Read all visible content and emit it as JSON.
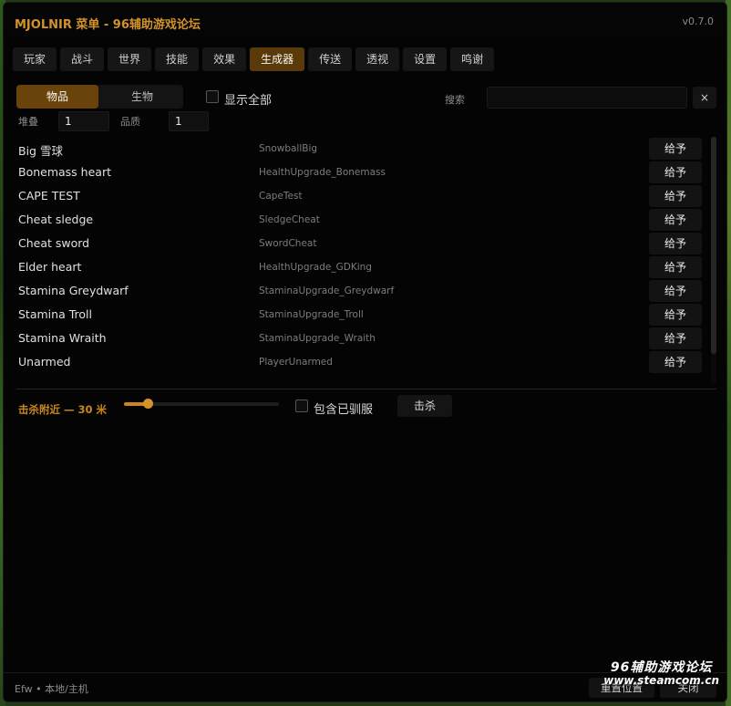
{
  "window": {
    "title": "MJOLNIR 菜单 - 96辅助游戏论坛",
    "version": "v0.7.0"
  },
  "tabs": [
    {
      "label": "玩家"
    },
    {
      "label": "战斗"
    },
    {
      "label": "世界"
    },
    {
      "label": "技能"
    },
    {
      "label": "效果"
    },
    {
      "label": "生成器",
      "active": true
    },
    {
      "label": "传送"
    },
    {
      "label": "透视"
    },
    {
      "label": "设置"
    },
    {
      "label": "鸣谢"
    }
  ],
  "spawner": {
    "segments": {
      "items": "物品",
      "creatures": "生物",
      "selected": "物品"
    },
    "show_all_label": "显示全部",
    "show_all_checked": false,
    "search_label": "搜索",
    "search_value": "",
    "clear_label": "×",
    "stack_label": "堆叠",
    "stack_value": "1",
    "quality_label": "品质",
    "quality_value": "1",
    "give_label": "给予",
    "items": [
      {
        "name": "Big 雪球",
        "id": "SnowballBig"
      },
      {
        "name": "Bonemass heart",
        "id": "HealthUpgrade_Bonemass"
      },
      {
        "name": "CAPE TEST",
        "id": "CapeTest"
      },
      {
        "name": "Cheat sledge",
        "id": "SledgeCheat"
      },
      {
        "name": "Cheat sword",
        "id": "SwordCheat"
      },
      {
        "name": "Elder heart",
        "id": "HealthUpgrade_GDKing"
      },
      {
        "name": "Stamina Greydwarf",
        "id": "StaminaUpgrade_Greydwarf"
      },
      {
        "name": "Stamina Troll",
        "id": "StaminaUpgrade_Troll"
      },
      {
        "name": "Stamina Wraith",
        "id": "StaminaUpgrade_Wraith"
      },
      {
        "name": "Unarmed",
        "id": "PlayerUnarmed"
      }
    ]
  },
  "kill": {
    "label": "击杀附近 — 30 米",
    "radius_value": 30,
    "radius_max": 200,
    "include_tamed_label": "包含已驯服",
    "include_tamed_checked": false,
    "button_label": "击杀"
  },
  "footer": {
    "status": "Efw • 本地/主机",
    "reset_label": "重置位置",
    "close_label": "关闭"
  },
  "watermark": {
    "line1": "96辅助游戏论坛",
    "line2": "www.steamcom.cn"
  },
  "colors": {
    "accent": "#d4922a",
    "active_tab": "#5a3a08",
    "background": "#040404"
  }
}
